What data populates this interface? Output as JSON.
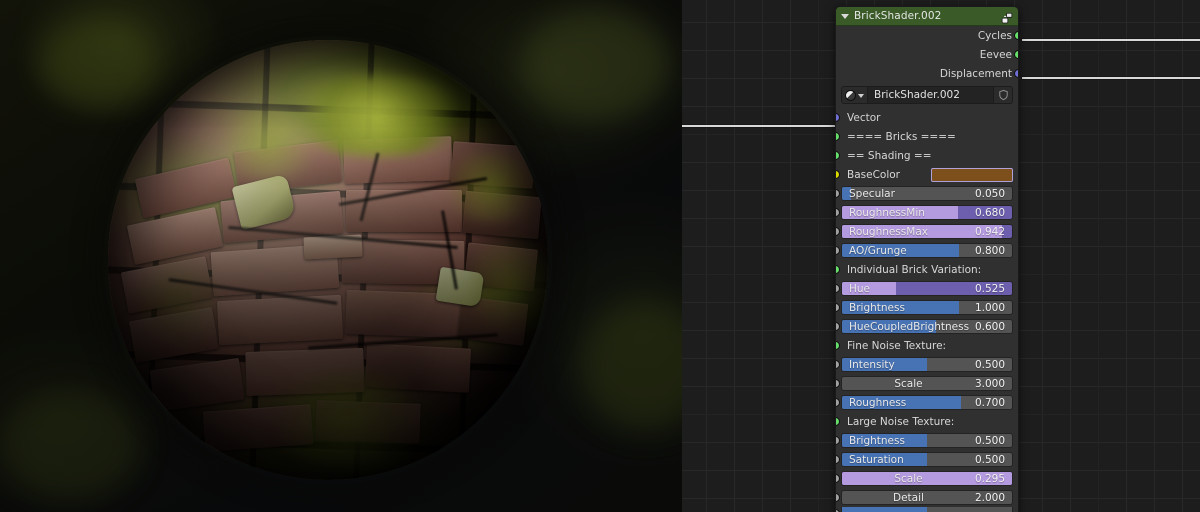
{
  "viewport": {
    "name": "3d-viewport-render",
    "description": "Rendered preview sphere with mossy brick procedural material"
  },
  "node_editor": {
    "name": "shader-node-editor",
    "grid": true,
    "background_color": "#1d1d1d"
  },
  "node": {
    "title": "BrickShader.002",
    "header_color": "#3a5a28",
    "body_color": "#303030",
    "collapse_icon": "triangle-down-icon",
    "header_icon": "node-group-link-icon",
    "outputs": [
      {
        "label": "Cycles",
        "socket_color": "#67dd6b",
        "connected": true
      },
      {
        "label": "Eevee",
        "socket_color": "#67dd6b",
        "connected": false
      },
      {
        "label": "Displacement",
        "socket_color": "#6f6fd4",
        "connected": true
      }
    ],
    "selector": {
      "icon": "material-ball-icon",
      "dropdown_icon": "chevron-down-icon",
      "value": "BrickShader.002",
      "placeholder": "Node Group",
      "fake_user_icon": "shield-icon"
    },
    "inputs": [
      {
        "kind": "socket-label",
        "label": "Vector",
        "socket_color": "#6f6fd4",
        "connected": true
      },
      {
        "kind": "separator",
        "label": "==== Bricks ====",
        "socket_color": "#67dd6b"
      },
      {
        "kind": "separator",
        "label": "== Shading ==",
        "socket_color": "#67dd6b"
      },
      {
        "kind": "color",
        "label": "BaseColor",
        "socket_color": "#d9d900",
        "swatch": "#7d4f1a"
      },
      {
        "kind": "slider",
        "label": "Specular",
        "value": "0.050",
        "fill_pct": 5,
        "style": "blue",
        "socket_color": "#a1a1a1"
      },
      {
        "kind": "slider",
        "label": "RoughnessMin",
        "value": "0.680",
        "fill_pct": 68,
        "style": "purple",
        "socket_color": "#a1a1a1"
      },
      {
        "kind": "slider",
        "label": "RoughnessMax",
        "value": "0.942",
        "fill_pct": 94,
        "style": "purple",
        "socket_color": "#a1a1a1"
      },
      {
        "kind": "slider",
        "label": "AO/Grunge",
        "value": "0.800",
        "fill_pct": 69,
        "style": "blue",
        "socket_color": "#a1a1a1"
      },
      {
        "kind": "separator",
        "label": "Individual Brick Variation:",
        "socket_color": "#67dd6b"
      },
      {
        "kind": "slider",
        "label": "Hue",
        "value": "0.525",
        "fill_pct": 32,
        "style": "purple",
        "socket_color": "#a1a1a1"
      },
      {
        "kind": "slider",
        "label": "Brightness",
        "value": "1.000",
        "fill_pct": 69,
        "style": "blue",
        "socket_color": "#a1a1a1"
      },
      {
        "kind": "slider",
        "label": "HueCoupledBrightness",
        "value": "0.600",
        "fill_pct": 55,
        "style": "blue",
        "socket_color": "#a1a1a1"
      },
      {
        "kind": "separator",
        "label": "Fine Noise Texture:",
        "socket_color": "#67dd6b"
      },
      {
        "kind": "slider",
        "label": "Intensity",
        "value": "0.500",
        "fill_pct": 50,
        "style": "blue",
        "socket_color": "#a1a1a1"
      },
      {
        "kind": "number",
        "label": "Scale",
        "value": "3.000",
        "socket_color": "#a1a1a1"
      },
      {
        "kind": "slider",
        "label": "Roughness",
        "value": "0.700",
        "fill_pct": 70,
        "style": "blue",
        "socket_color": "#a1a1a1"
      },
      {
        "kind": "separator",
        "label": "Large Noise Texture:",
        "socket_color": "#67dd6b"
      },
      {
        "kind": "slider",
        "label": "Brightness",
        "value": "0.500",
        "fill_pct": 50,
        "style": "blue",
        "socket_color": "#a1a1a1"
      },
      {
        "kind": "slider",
        "label": "Saturation",
        "value": "0.500",
        "fill_pct": 50,
        "style": "blue",
        "socket_color": "#a1a1a1"
      },
      {
        "kind": "slider",
        "label": "Scale",
        "value": "0.295",
        "fill_pct": 100,
        "style": "purple",
        "socket_color": "#a1a1a1"
      },
      {
        "kind": "number",
        "label": "Detail",
        "value": "2.000",
        "socket_color": "#a1a1a1"
      },
      {
        "kind": "clipped",
        "label": "",
        "value": "",
        "fill_pct": 50,
        "style": "blue",
        "socket_color": "#a1a1a1"
      }
    ]
  },
  "colors": {
    "accent_green": "#67dd6b",
    "accent_purple": "#6f6fd4",
    "slider_blue": "#4772b3",
    "slider_purple": "#b49adf",
    "purple_track": "#6d5fae",
    "basecolor_swatch": "#7d4f1a",
    "node_header": "#3a5a28",
    "wire": "#d8d8d8"
  }
}
